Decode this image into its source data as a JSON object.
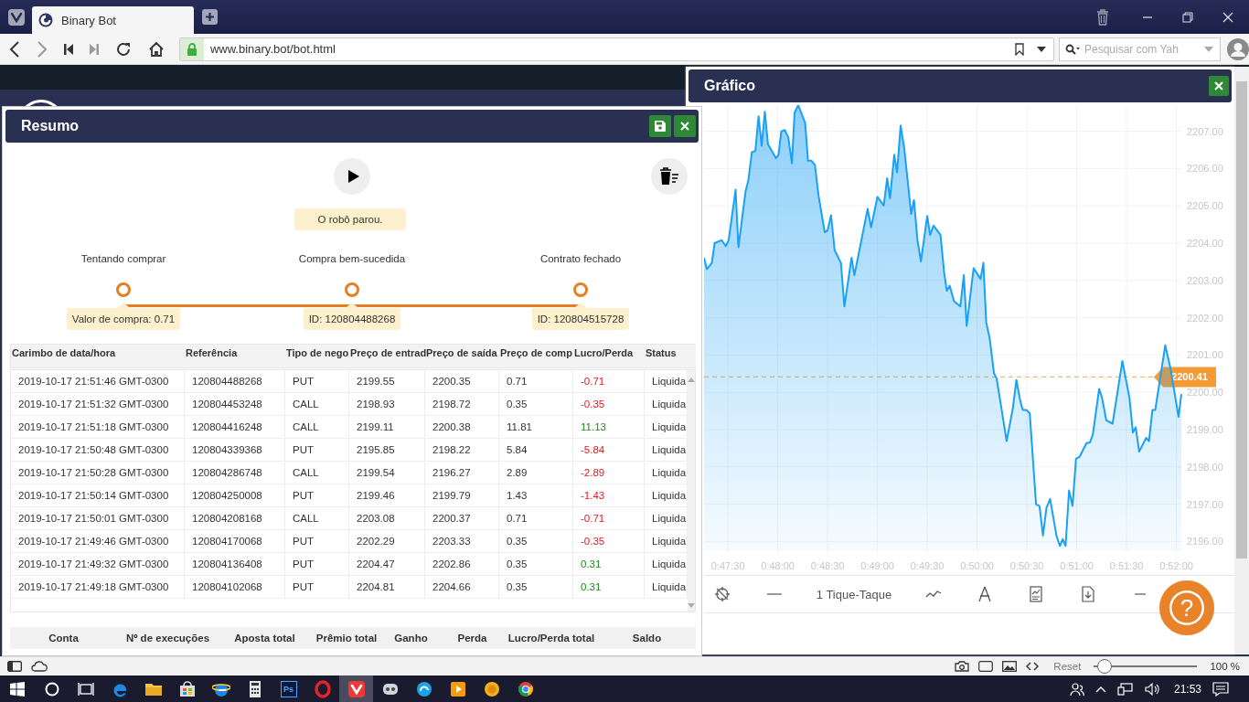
{
  "browser": {
    "tab": {
      "title": "Binary Bot"
    },
    "url": "www.binary.bot/bot.html",
    "search": {
      "placeholder": "Pesquisar com Yah"
    }
  },
  "summary_panel": {
    "title": "Resumo",
    "status": "O robô parou.",
    "steps": [
      {
        "label": "Tentando comprar",
        "detail": "Valor de compra: 0.71"
      },
      {
        "label": "Compra bem-sucedida",
        "detail": "ID: 120804488268"
      },
      {
        "label": "Contrato fechado",
        "detail": "ID: 120804515728"
      }
    ],
    "table": {
      "columns": [
        "Carimbo de data/hora",
        "Referência",
        "Tipo de nego",
        "Preço de entrad",
        "Preço de saída",
        "Preço de comp",
        "Lucro/Perda",
        "Status"
      ],
      "rows": [
        {
          "cells": [
            "2019-10-17 21:51:46 GMT-0300",
            "120804488268",
            "PUT",
            "2199.55",
            "2200.35",
            "0.71",
            "-0.71",
            "Liquida"
          ],
          "won": false
        },
        {
          "cells": [
            "2019-10-17 21:51:32 GMT-0300",
            "120804453248",
            "CALL",
            "2198.93",
            "2198.72",
            "0.35",
            "-0.35",
            "Liquida"
          ],
          "won": false
        },
        {
          "cells": [
            "2019-10-17 21:51:18 GMT-0300",
            "120804416248",
            "CALL",
            "2199.11",
            "2200.38",
            "11.81",
            "11.13",
            "Liquida"
          ],
          "won": true
        },
        {
          "cells": [
            "2019-10-17 21:50:48 GMT-0300",
            "120804339368",
            "PUT",
            "2195.85",
            "2198.22",
            "5.84",
            "-5.84",
            "Liquida"
          ],
          "won": false
        },
        {
          "cells": [
            "2019-10-17 21:50:28 GMT-0300",
            "120804286748",
            "CALL",
            "2199.54",
            "2196.27",
            "2.89",
            "-2.89",
            "Liquida"
          ],
          "won": false
        },
        {
          "cells": [
            "2019-10-17 21:50:14 GMT-0300",
            "120804250008",
            "PUT",
            "2199.46",
            "2199.79",
            "1.43",
            "-1.43",
            "Liquida"
          ],
          "won": false
        },
        {
          "cells": [
            "2019-10-17 21:50:01 GMT-0300",
            "120804208168",
            "CALL",
            "2203.08",
            "2200.37",
            "0.71",
            "-0.71",
            "Liquida"
          ],
          "won": false
        },
        {
          "cells": [
            "2019-10-17 21:49:46 GMT-0300",
            "120804170068",
            "PUT",
            "2202.29",
            "2203.33",
            "0.35",
            "-0.35",
            "Liquida"
          ],
          "won": false
        },
        {
          "cells": [
            "2019-10-17 21:49:32 GMT-0300",
            "120804136408",
            "PUT",
            "2204.47",
            "2202.86",
            "0.35",
            "0.31",
            "Liquida"
          ],
          "won": true
        },
        {
          "cells": [
            "2019-10-17 21:49:18 GMT-0300",
            "120804102068",
            "PUT",
            "2204.81",
            "2204.66",
            "0.35",
            "0.31",
            "Liquida"
          ],
          "won": true
        }
      ]
    },
    "totals": {
      "columns": [
        "Conta",
        "Nº de execuções",
        "Aposta total",
        "Prêmio total",
        "Ganho",
        "Perda",
        "Lucro/Perda total",
        "Saldo"
      ]
    }
  },
  "chart_panel": {
    "title": "Gráfico",
    "chart_data": {
      "type": "area",
      "x": [
        2835.6,
        2837.3,
        2840.3,
        2842.0,
        2846.2,
        2848.7,
        2850.4,
        2854.6,
        2856.3,
        2860.6,
        2862.3,
        2864.4,
        2866.5,
        2868.4,
        2870.3,
        2872.2,
        2874.1,
        2878.9,
        2880.4,
        2882.1,
        2884.2,
        2886.3,
        2888.5,
        2890.1,
        2892.3,
        2896.5,
        2898.2,
        2900.3,
        2902.4,
        2904.5,
        2908.3,
        2910.0,
        2912.1,
        2914.2,
        2918.0,
        2920.1,
        2924.4,
        2926.1,
        2929.9,
        2934.1,
        2936.2,
        2940.0,
        2943.8,
        2945.9,
        2947.6,
        2950.1,
        2951.8,
        2954.0,
        2956.1,
        2960.3,
        2962.0,
        2964.1,
        2966.2,
        2970.0,
        2971.7,
        2973.8,
        2978.0,
        2980.1,
        2981.8,
        2983.5,
        2986.1,
        2989.9,
        2992.0,
        2993.7,
        2997.9,
        3002.1,
        3003.8,
        3005.5,
        3007.6,
        3010.2,
        3011.8,
        3014.8,
        3017.8,
        3021.6,
        3023.7,
        3025.8,
        3027.5,
        3029.6,
        3031.7,
        3035.5,
        3037.6,
        3039.7,
        3041.8,
        3044.0,
        3047.8,
        3049.9,
        3051.6,
        3053.3,
        3055.4,
        3057.5,
        3059.6,
        3061.7,
        3065.9,
        3068.0,
        3069.7,
        3073.5,
        3075.2,
        3077.8,
        3081.6,
        3087.5,
        3091.7,
        3093.8,
        3095.5,
        3097.6,
        3101.8,
        3103.5,
        3105.6,
        3107.3,
        3113.3,
        3116.6,
        3121.3,
        3123.0
      ],
      "series": [
        {
          "color": "#1aa0f5",
          "values": [
            2203.61,
            2203.3,
            2203.47,
            2204.0,
            2204.08,
            2203.92,
            2204.08,
            2205.43,
            2203.89,
            2205.39,
            2205.69,
            2206.44,
            2206.47,
            2207.4,
            2206.61,
            2207.52,
            2206.65,
            2206.28,
            2206.37,
            2207.0,
            2207.03,
            2206.84,
            2206.14,
            2207.5,
            2207.7,
            2207.22,
            2206.21,
            2206.21,
            2206.09,
            2205.29,
            2204.29,
            2204.34,
            2204.75,
            2203.81,
            2203.47,
            2202.3,
            2203.61,
            2203.14,
            2203.98,
            2204.92,
            2204.42,
            2205.24,
            2205.01,
            2205.74,
            2205.2,
            2206.37,
            2205.9,
            2207.15,
            2206.56,
            2204.78,
            2205.15,
            2204.08,
            2203.51,
            2204.73,
            2204.22,
            2204.47,
            2204.22,
            2203.23,
            2202.72,
            2202.86,
            2202.44,
            2202.3,
            2203.14,
            2201.78,
            2203.33,
            2203.04,
            2203.47,
            2201.87,
            2201.45,
            2200.51,
            2200.37,
            2199.53,
            2198.69,
            2199.58,
            2200.33,
            2199.81,
            2199.53,
            2199.53,
            2199.44,
            2197.0,
            2196.95,
            2196.16,
            2196.91,
            2197.14,
            2196.16,
            2195.88,
            2196.06,
            2195.88,
            2197.37,
            2196.95,
            2198.22,
            2198.27,
            2198.64,
            2198.66,
            2198.87,
            2200.09,
            2199.86,
            2199.25,
            2199.16,
            2200.84,
            2199.86,
            2198.92,
            2199.06,
            2198.41,
            2198.78,
            2198.69,
            2199.53,
            2199.53,
            2201.26,
            2200.61,
            2199.34,
            2199.95
          ]
        }
      ],
      "grid": true,
      "xlim": [
        2835.6,
        3123
      ],
      "ylim": [
        2195.74,
        2207.7
      ],
      "xticks": [
        {
          "value": 2850,
          "label": "0:47:30"
        },
        {
          "value": 2880,
          "label": "0:48:00"
        },
        {
          "value": 2910,
          "label": "0:48:30"
        },
        {
          "value": 2940,
          "label": "0:49:00"
        },
        {
          "value": 2970,
          "label": "0:49:30"
        },
        {
          "value": 3000,
          "label": "0:50:00"
        },
        {
          "value": 3030,
          "label": "0:50:30"
        },
        {
          "value": 3060,
          "label": "0:51:00"
        },
        {
          "value": 3090,
          "label": "0:51:30"
        },
        {
          "value": 3120,
          "label": "0:52:00"
        }
      ],
      "yticks": [
        {
          "value": 2196,
          "label": "2196.00"
        },
        {
          "value": 2197,
          "label": "2197.00"
        },
        {
          "value": 2198,
          "label": "2198.00"
        },
        {
          "value": 2199,
          "label": "2199.00"
        },
        {
          "value": 2200,
          "label": "2200.00"
        },
        {
          "value": 2201,
          "label": "2201.00"
        },
        {
          "value": 2202,
          "label": "2202.00"
        },
        {
          "value": 2203,
          "label": "2203.00"
        },
        {
          "value": 2204,
          "label": "2204.00"
        },
        {
          "value": 2205,
          "label": "2205.00"
        },
        {
          "value": 2206,
          "label": "2206.00"
        },
        {
          "value": 2207,
          "label": "2207.00"
        }
      ],
      "ref_lines": [
        {
          "axis": "y",
          "value": 2200.41,
          "label": "2200.41"
        }
      ]
    },
    "toolbar": {
      "interval": "1 Tique-Taque"
    },
    "help_button": "?"
  },
  "status_bar": {
    "reset": "Reset",
    "zoom_slider": {
      "level": 0.1
    },
    "zoom": "100 %"
  },
  "taskbar": {
    "apps": [
      {
        "kind": "browser",
        "selected": false
      },
      {
        "kind": "folder",
        "selected": false
      },
      {
        "kind": "bag",
        "selected": false
      },
      {
        "kind": "globe",
        "selected": false
      },
      {
        "kind": "calculator",
        "selected": false
      },
      {
        "kind": "ps",
        "label": "Ps",
        "selected": false
      },
      {
        "kind": "ring",
        "selected": false
      },
      {
        "kind": "v",
        "selected": true
      },
      {
        "kind": "robot",
        "selected": false
      },
      {
        "kind": "swirl",
        "selected": false
      },
      {
        "kind": "play",
        "selected": false
      },
      {
        "kind": "coin",
        "selected": false
      },
      {
        "kind": "ball",
        "selected": false
      }
    ],
    "clock": "21:53"
  }
}
